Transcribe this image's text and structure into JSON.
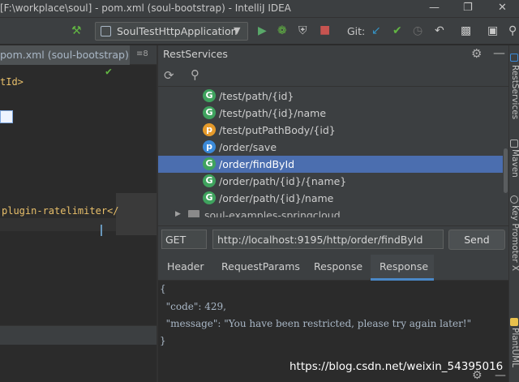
{
  "window": {
    "title": "[F:\\workplace\\soul] - pom.xml (soul-bootstrap) - IntelliJ IDEA"
  },
  "toolbar": {
    "run_config": "SoulTestHttpApplication",
    "git_label": "Git:"
  },
  "editor": {
    "tab_label": "pom.xml (soul-bootstrap)",
    "tab_overflow": "≡8",
    "lines": [
      "tId>",
      "plugin-ratelimiter</"
    ]
  },
  "rest_services": {
    "title": "RestServices",
    "routes": [
      {
        "badge": "G",
        "path": "/test/path/{id}",
        "selected": false
      },
      {
        "badge": "G",
        "path": "/test/path/{id}/name",
        "selected": false
      },
      {
        "badge": "p",
        "path": "/test/putPathBody/{id}",
        "selected": false
      },
      {
        "badge": "p",
        "path": "/order/save",
        "selected": false
      },
      {
        "badge": "G",
        "path": "/order/findById",
        "selected": true
      },
      {
        "badge": "G",
        "path": "/order/path/{id}/{name}",
        "selected": false
      },
      {
        "badge": "G",
        "path": "/order/path/{id}/name",
        "selected": false
      }
    ],
    "folder_node": "soul-examples-springcloud"
  },
  "request": {
    "method": "GET",
    "url": "http://localhost:9195/http/order/findById",
    "send_label": "Send"
  },
  "tabs": [
    "Header",
    "RequestParams",
    "Response",
    "Response"
  ],
  "response": {
    "lines": [
      "{",
      "  \"code\": 429,",
      "  \"message\": \"You have been restricted, please try again later!\"",
      "}"
    ]
  },
  "side_strip": {
    "labels": [
      "RestServices",
      "Maven",
      "Key Promoter X",
      "PlantUML"
    ]
  },
  "watermark": "https://blog.csdn.net/weixin_54395016"
}
